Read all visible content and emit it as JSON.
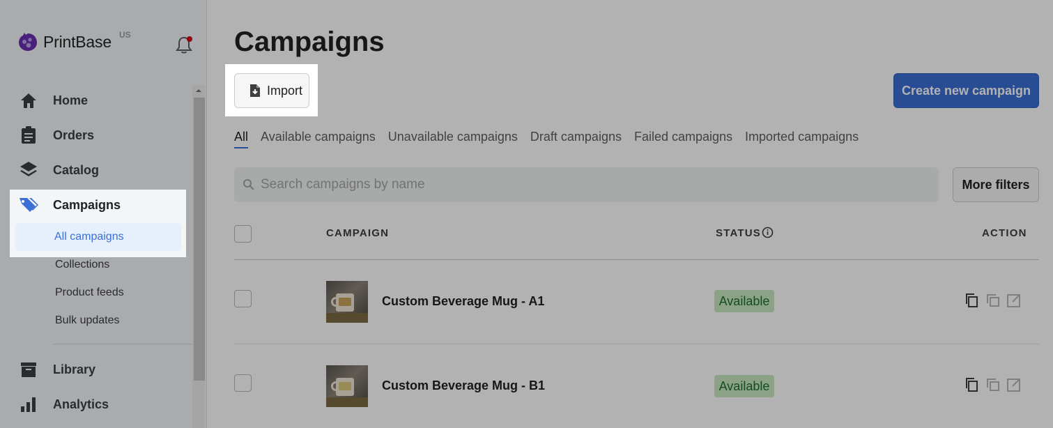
{
  "brand": {
    "name": "PrintBase",
    "region": "US"
  },
  "sidebar": {
    "nav": [
      {
        "label": "Home",
        "icon": "home-icon"
      },
      {
        "label": "Orders",
        "icon": "clipboard-icon"
      },
      {
        "label": "Catalog",
        "icon": "layers-icon"
      },
      {
        "label": "Campaigns",
        "icon": "tags-icon"
      },
      {
        "label": "Library",
        "icon": "archive-icon"
      },
      {
        "label": "Analytics",
        "icon": "bar-chart-icon"
      }
    ],
    "campaigns_sub": [
      "All campaigns",
      "Collections",
      "Product feeds",
      "Bulk updates"
    ]
  },
  "page": {
    "title": "Campaigns",
    "import_label": "Import",
    "create_label": "Create new campaign",
    "tabs": [
      "All",
      "Available campaigns",
      "Unavailable campaigns",
      "Draft campaigns",
      "Failed campaigns",
      "Imported campaigns"
    ],
    "active_tab": "All",
    "search_placeholder": "Search campaigns by name",
    "more_filters_label": "More filters"
  },
  "table": {
    "columns": {
      "campaign": "CAMPAIGN",
      "status": "STATUS",
      "action": "ACTION"
    },
    "rows": [
      {
        "name": "Custom Beverage Mug - A1",
        "status": "Available"
      },
      {
        "name": "Custom Beverage Mug - B1",
        "status": "Available"
      }
    ]
  },
  "colors": {
    "accent": "#3a6fd6",
    "status_bg": "#c9e8c0",
    "status_text": "#1f6d2a",
    "notification_dot": "#d0021b"
  }
}
